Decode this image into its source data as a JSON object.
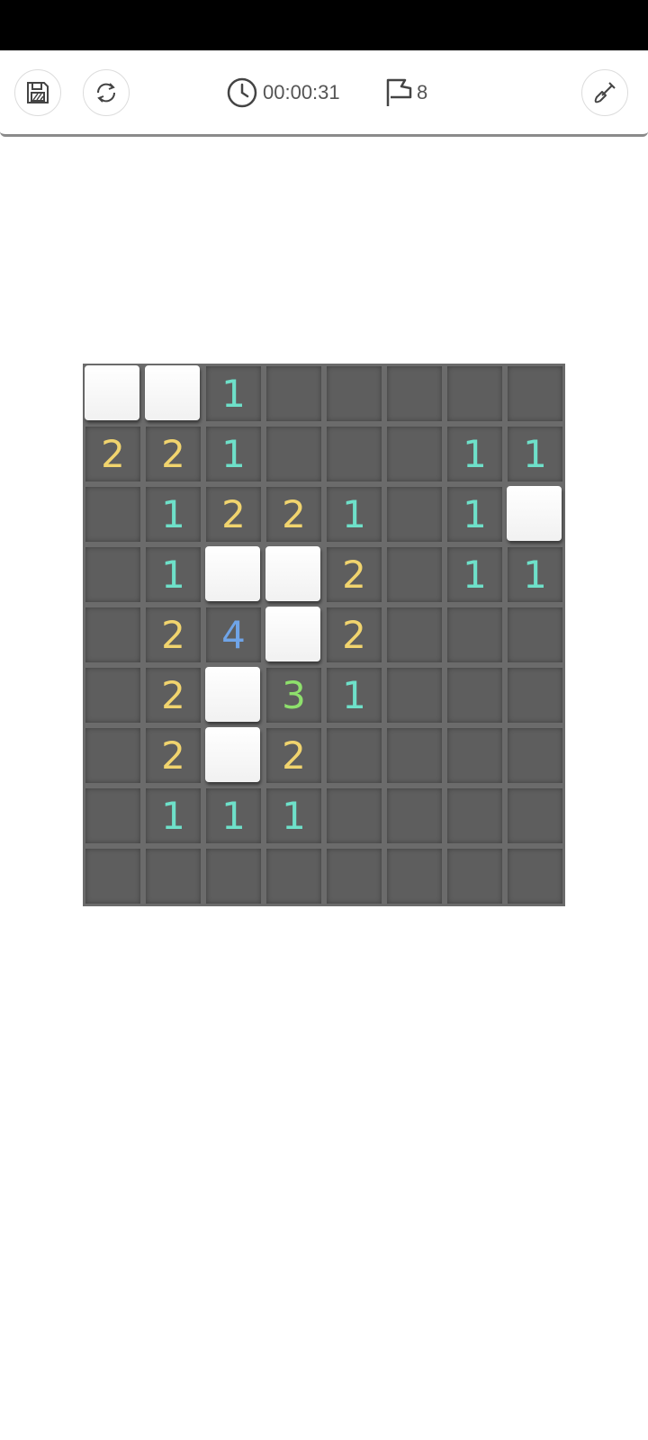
{
  "toolbar": {
    "save_icon": "floppy-disk-icon",
    "restart_icon": "refresh-icon",
    "timer_icon": "clock-icon",
    "timer": "00:00:31",
    "flag_icon": "flag-icon",
    "flags": "8",
    "mode_icon": "shovel-icon"
  },
  "colors": {
    "1": "#6ee0c9",
    "2": "#f1d46e",
    "3": "#8ee06c",
    "4": "#6fa4e8",
    "cell_revealed": "#5e5e5e",
    "cell_hidden": "#ffffff",
    "board_border": "#6b6b6b"
  },
  "board": {
    "rows": 9,
    "cols": 8,
    "cells": [
      [
        "H",
        "H",
        "1",
        "0",
        "0",
        "0",
        "0",
        "0"
      ],
      [
        "2",
        "2",
        "1",
        "0",
        "0",
        "0",
        "1",
        "1"
      ],
      [
        "0",
        "1",
        "2",
        "2",
        "1",
        "0",
        "1",
        "H"
      ],
      [
        "0",
        "1",
        "H",
        "H",
        "2",
        "0",
        "1",
        "1"
      ],
      [
        "0",
        "2",
        "4",
        "H",
        "2",
        "0",
        "0",
        "0"
      ],
      [
        "0",
        "2",
        "H",
        "3",
        "1",
        "0",
        "0",
        "0"
      ],
      [
        "0",
        "2",
        "H",
        "2",
        "0",
        "0",
        "0",
        "0"
      ],
      [
        "0",
        "1",
        "1",
        "1",
        "0",
        "0",
        "0",
        "0"
      ],
      [
        "0",
        "0",
        "0",
        "0",
        "0",
        "0",
        "0",
        "0"
      ]
    ]
  }
}
